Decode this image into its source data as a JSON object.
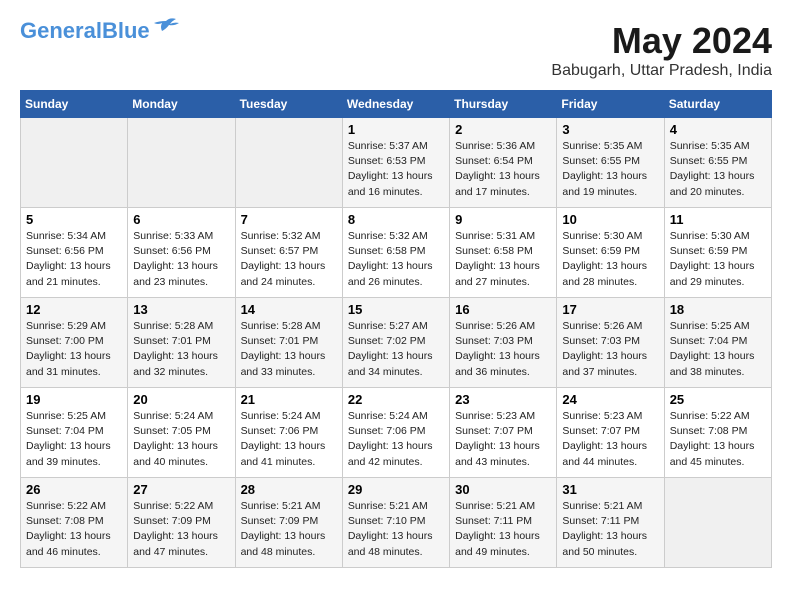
{
  "header": {
    "logo_line1": "General",
    "logo_line2": "Blue",
    "month_year": "May 2024",
    "location": "Babugarh, Uttar Pradesh, India"
  },
  "weekdays": [
    "Sunday",
    "Monday",
    "Tuesday",
    "Wednesday",
    "Thursday",
    "Friday",
    "Saturday"
  ],
  "weeks": [
    [
      {
        "day": "",
        "info": ""
      },
      {
        "day": "",
        "info": ""
      },
      {
        "day": "",
        "info": ""
      },
      {
        "day": "1",
        "info": "Sunrise: 5:37 AM\nSunset: 6:53 PM\nDaylight: 13 hours\nand 16 minutes."
      },
      {
        "day": "2",
        "info": "Sunrise: 5:36 AM\nSunset: 6:54 PM\nDaylight: 13 hours\nand 17 minutes."
      },
      {
        "day": "3",
        "info": "Sunrise: 5:35 AM\nSunset: 6:55 PM\nDaylight: 13 hours\nand 19 minutes."
      },
      {
        "day": "4",
        "info": "Sunrise: 5:35 AM\nSunset: 6:55 PM\nDaylight: 13 hours\nand 20 minutes."
      }
    ],
    [
      {
        "day": "5",
        "info": "Sunrise: 5:34 AM\nSunset: 6:56 PM\nDaylight: 13 hours\nand 21 minutes."
      },
      {
        "day": "6",
        "info": "Sunrise: 5:33 AM\nSunset: 6:56 PM\nDaylight: 13 hours\nand 23 minutes."
      },
      {
        "day": "7",
        "info": "Sunrise: 5:32 AM\nSunset: 6:57 PM\nDaylight: 13 hours\nand 24 minutes."
      },
      {
        "day": "8",
        "info": "Sunrise: 5:32 AM\nSunset: 6:58 PM\nDaylight: 13 hours\nand 26 minutes."
      },
      {
        "day": "9",
        "info": "Sunrise: 5:31 AM\nSunset: 6:58 PM\nDaylight: 13 hours\nand 27 minutes."
      },
      {
        "day": "10",
        "info": "Sunrise: 5:30 AM\nSunset: 6:59 PM\nDaylight: 13 hours\nand 28 minutes."
      },
      {
        "day": "11",
        "info": "Sunrise: 5:30 AM\nSunset: 6:59 PM\nDaylight: 13 hours\nand 29 minutes."
      }
    ],
    [
      {
        "day": "12",
        "info": "Sunrise: 5:29 AM\nSunset: 7:00 PM\nDaylight: 13 hours\nand 31 minutes."
      },
      {
        "day": "13",
        "info": "Sunrise: 5:28 AM\nSunset: 7:01 PM\nDaylight: 13 hours\nand 32 minutes."
      },
      {
        "day": "14",
        "info": "Sunrise: 5:28 AM\nSunset: 7:01 PM\nDaylight: 13 hours\nand 33 minutes."
      },
      {
        "day": "15",
        "info": "Sunrise: 5:27 AM\nSunset: 7:02 PM\nDaylight: 13 hours\nand 34 minutes."
      },
      {
        "day": "16",
        "info": "Sunrise: 5:26 AM\nSunset: 7:03 PM\nDaylight: 13 hours\nand 36 minutes."
      },
      {
        "day": "17",
        "info": "Sunrise: 5:26 AM\nSunset: 7:03 PM\nDaylight: 13 hours\nand 37 minutes."
      },
      {
        "day": "18",
        "info": "Sunrise: 5:25 AM\nSunset: 7:04 PM\nDaylight: 13 hours\nand 38 minutes."
      }
    ],
    [
      {
        "day": "19",
        "info": "Sunrise: 5:25 AM\nSunset: 7:04 PM\nDaylight: 13 hours\nand 39 minutes."
      },
      {
        "day": "20",
        "info": "Sunrise: 5:24 AM\nSunset: 7:05 PM\nDaylight: 13 hours\nand 40 minutes."
      },
      {
        "day": "21",
        "info": "Sunrise: 5:24 AM\nSunset: 7:06 PM\nDaylight: 13 hours\nand 41 minutes."
      },
      {
        "day": "22",
        "info": "Sunrise: 5:24 AM\nSunset: 7:06 PM\nDaylight: 13 hours\nand 42 minutes."
      },
      {
        "day": "23",
        "info": "Sunrise: 5:23 AM\nSunset: 7:07 PM\nDaylight: 13 hours\nand 43 minutes."
      },
      {
        "day": "24",
        "info": "Sunrise: 5:23 AM\nSunset: 7:07 PM\nDaylight: 13 hours\nand 44 minutes."
      },
      {
        "day": "25",
        "info": "Sunrise: 5:22 AM\nSunset: 7:08 PM\nDaylight: 13 hours\nand 45 minutes."
      }
    ],
    [
      {
        "day": "26",
        "info": "Sunrise: 5:22 AM\nSunset: 7:08 PM\nDaylight: 13 hours\nand 46 minutes."
      },
      {
        "day": "27",
        "info": "Sunrise: 5:22 AM\nSunset: 7:09 PM\nDaylight: 13 hours\nand 47 minutes."
      },
      {
        "day": "28",
        "info": "Sunrise: 5:21 AM\nSunset: 7:09 PM\nDaylight: 13 hours\nand 48 minutes."
      },
      {
        "day": "29",
        "info": "Sunrise: 5:21 AM\nSunset: 7:10 PM\nDaylight: 13 hours\nand 48 minutes."
      },
      {
        "day": "30",
        "info": "Sunrise: 5:21 AM\nSunset: 7:11 PM\nDaylight: 13 hours\nand 49 minutes."
      },
      {
        "day": "31",
        "info": "Sunrise: 5:21 AM\nSunset: 7:11 PM\nDaylight: 13 hours\nand 50 minutes."
      },
      {
        "day": "",
        "info": ""
      }
    ]
  ]
}
